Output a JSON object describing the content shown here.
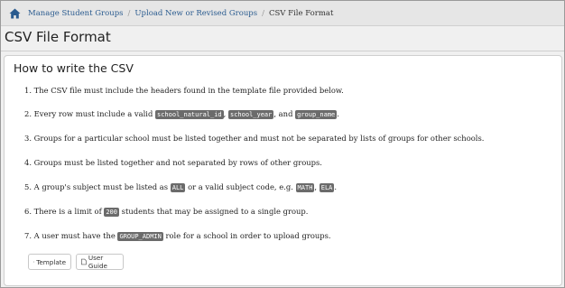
{
  "breadcrumb": {
    "items": [
      "Manage Student Groups",
      "Upload New or Revised Groups"
    ],
    "current": "CSV File Format",
    "separator": "/"
  },
  "page": {
    "title": "CSV File Format"
  },
  "panel": {
    "heading": "How to write the CSV",
    "rules": [
      {
        "num": "1.",
        "pre": "The CSV file must include the headers found in the template file provided below."
      },
      {
        "num": "2.",
        "pre": "Every row must include a valid",
        "code1": "school_natural_id",
        "mid1": ",",
        "code2": "school_year",
        "mid2": ", and",
        "code3": "group_name",
        "post": "."
      },
      {
        "num": "3.",
        "pre": "Groups for a particular school must be listed together and must not be separated by lists of groups for other schools."
      },
      {
        "num": "4.",
        "pre": "Groups must be listed together and not separated by rows of other groups."
      },
      {
        "num": "5.",
        "pre": "A group's subject must be listed as",
        "code1": "ALL",
        "mid1": "or a valid subject code, e.g.",
        "code2": "MATH",
        "mid2": ",",
        "code3": "ELA",
        "post": "."
      },
      {
        "num": "6.",
        "pre": "There is a limit of",
        "code1": "200",
        "post": "students that may be assigned to a single group."
      },
      {
        "num": "7.",
        "pre": "A user must have the",
        "code1": "GROUP_ADMIN",
        "post": "role for a school in order to upload groups."
      }
    ]
  },
  "buttons": {
    "template_label": "Template",
    "user_guide_label": "User Guide"
  },
  "colors": {
    "link": "#2a5b8f",
    "code_bg": "#6b6b6b"
  }
}
